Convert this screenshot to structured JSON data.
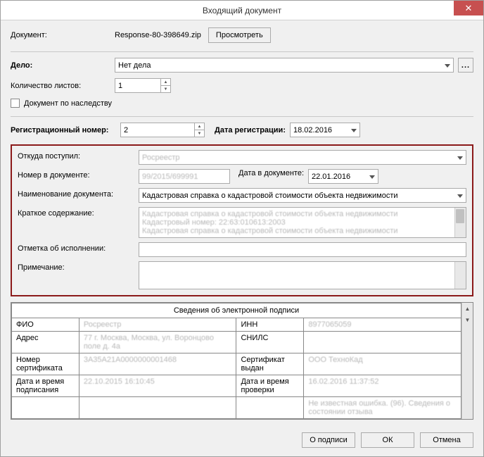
{
  "window": {
    "title": "Входящий документ",
    "close": "✕"
  },
  "top": {
    "document_label": "Документ:",
    "document_value": "Response-80-398649.zip",
    "view_button": "Просмотреть",
    "case_label": "Дело:",
    "case_value": "Нет дела",
    "ellipsis": "...",
    "sheets_label": "Количество листов:",
    "sheets_value": "1",
    "inheritance_label": "Документ по наследству",
    "reg_num_label": "Регистрационный номер:",
    "reg_num_value": "2",
    "reg_date_label": "Дата регистрации:",
    "reg_date_value": "18.02.2016"
  },
  "details": {
    "from_label": "Откуда поступил:",
    "from_value": "Росреестр",
    "docnum_label": "Номер в документе:",
    "docnum_value": "99/2015/699991",
    "docdate_label": "Дата в документе:",
    "docdate_value": "22.01.2016",
    "name_label": "Наименование документа:",
    "name_value": "Кадастровая справка о кадастровой стоимости объекта недвижимости",
    "summary_label": "Краткое содержание:",
    "summary_line1": "Кадастровая справка о кадастровой стоимости объекта недвижимости",
    "summary_line2": "Кадастровый номер: 22:63:010613:2003",
    "summary_line3": "Кадастровая справка о кадастровой стоимости объекта недвижимости",
    "exec_label": "Отметка об исполнении:",
    "exec_value": "",
    "note_label": "Примечание:",
    "note_value": ""
  },
  "signature": {
    "title": "Сведения об электронной подписи",
    "rows": [
      {
        "l1": "ФИО",
        "v1": "Росреестр",
        "l2": "ИНН",
        "v2": "8977065059"
      },
      {
        "l1": "Адрес",
        "v1": "77 г. Москва, Москва, ул. Воронцово поле д. 4а",
        "l2": "СНИЛС",
        "v2": ""
      },
      {
        "l1": "Номер сертификата",
        "v1": "3A35A21A0000000001468",
        "l2": "Сертификат выдан",
        "v2": "ООО ТехноКад"
      },
      {
        "l1": "Дата и время подписания",
        "v1": "22.10.2015 16:10:45",
        "l2": "Дата и время проверки",
        "v2": "16.02.2016 11:37:52"
      },
      {
        "l1": "",
        "v1": "",
        "l2": "",
        "v2": "Не известная ошибка. (96). Сведения о состоянии отзыва"
      }
    ]
  },
  "footer": {
    "about": "О подписи",
    "ok": "ОК",
    "cancel": "Отмена"
  }
}
